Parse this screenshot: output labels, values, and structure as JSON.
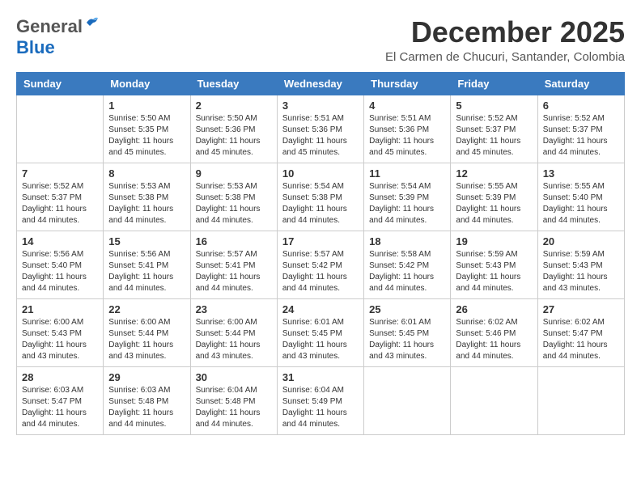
{
  "header": {
    "logo_general": "General",
    "logo_blue": "Blue",
    "month_title": "December 2025",
    "location": "El Carmen de Chucuri, Santander, Colombia"
  },
  "calendar": {
    "days_of_week": [
      "Sunday",
      "Monday",
      "Tuesday",
      "Wednesday",
      "Thursday",
      "Friday",
      "Saturday"
    ],
    "weeks": [
      [
        {
          "day": "",
          "info": ""
        },
        {
          "day": "1",
          "info": "Sunrise: 5:50 AM\nSunset: 5:35 PM\nDaylight: 11 hours\nand 45 minutes."
        },
        {
          "day": "2",
          "info": "Sunrise: 5:50 AM\nSunset: 5:36 PM\nDaylight: 11 hours\nand 45 minutes."
        },
        {
          "day": "3",
          "info": "Sunrise: 5:51 AM\nSunset: 5:36 PM\nDaylight: 11 hours\nand 45 minutes."
        },
        {
          "day": "4",
          "info": "Sunrise: 5:51 AM\nSunset: 5:36 PM\nDaylight: 11 hours\nand 45 minutes."
        },
        {
          "day": "5",
          "info": "Sunrise: 5:52 AM\nSunset: 5:37 PM\nDaylight: 11 hours\nand 45 minutes."
        },
        {
          "day": "6",
          "info": "Sunrise: 5:52 AM\nSunset: 5:37 PM\nDaylight: 11 hours\nand 44 minutes."
        }
      ],
      [
        {
          "day": "7",
          "info": "Sunrise: 5:52 AM\nSunset: 5:37 PM\nDaylight: 11 hours\nand 44 minutes."
        },
        {
          "day": "8",
          "info": "Sunrise: 5:53 AM\nSunset: 5:38 PM\nDaylight: 11 hours\nand 44 minutes."
        },
        {
          "day": "9",
          "info": "Sunrise: 5:53 AM\nSunset: 5:38 PM\nDaylight: 11 hours\nand 44 minutes."
        },
        {
          "day": "10",
          "info": "Sunrise: 5:54 AM\nSunset: 5:38 PM\nDaylight: 11 hours\nand 44 minutes."
        },
        {
          "day": "11",
          "info": "Sunrise: 5:54 AM\nSunset: 5:39 PM\nDaylight: 11 hours\nand 44 minutes."
        },
        {
          "day": "12",
          "info": "Sunrise: 5:55 AM\nSunset: 5:39 PM\nDaylight: 11 hours\nand 44 minutes."
        },
        {
          "day": "13",
          "info": "Sunrise: 5:55 AM\nSunset: 5:40 PM\nDaylight: 11 hours\nand 44 minutes."
        }
      ],
      [
        {
          "day": "14",
          "info": "Sunrise: 5:56 AM\nSunset: 5:40 PM\nDaylight: 11 hours\nand 44 minutes."
        },
        {
          "day": "15",
          "info": "Sunrise: 5:56 AM\nSunset: 5:41 PM\nDaylight: 11 hours\nand 44 minutes."
        },
        {
          "day": "16",
          "info": "Sunrise: 5:57 AM\nSunset: 5:41 PM\nDaylight: 11 hours\nand 44 minutes."
        },
        {
          "day": "17",
          "info": "Sunrise: 5:57 AM\nSunset: 5:42 PM\nDaylight: 11 hours\nand 44 minutes."
        },
        {
          "day": "18",
          "info": "Sunrise: 5:58 AM\nSunset: 5:42 PM\nDaylight: 11 hours\nand 44 minutes."
        },
        {
          "day": "19",
          "info": "Sunrise: 5:59 AM\nSunset: 5:43 PM\nDaylight: 11 hours\nand 44 minutes."
        },
        {
          "day": "20",
          "info": "Sunrise: 5:59 AM\nSunset: 5:43 PM\nDaylight: 11 hours\nand 43 minutes."
        }
      ],
      [
        {
          "day": "21",
          "info": "Sunrise: 6:00 AM\nSunset: 5:43 PM\nDaylight: 11 hours\nand 43 minutes."
        },
        {
          "day": "22",
          "info": "Sunrise: 6:00 AM\nSunset: 5:44 PM\nDaylight: 11 hours\nand 43 minutes."
        },
        {
          "day": "23",
          "info": "Sunrise: 6:00 AM\nSunset: 5:44 PM\nDaylight: 11 hours\nand 43 minutes."
        },
        {
          "day": "24",
          "info": "Sunrise: 6:01 AM\nSunset: 5:45 PM\nDaylight: 11 hours\nand 43 minutes."
        },
        {
          "day": "25",
          "info": "Sunrise: 6:01 AM\nSunset: 5:45 PM\nDaylight: 11 hours\nand 43 minutes."
        },
        {
          "day": "26",
          "info": "Sunrise: 6:02 AM\nSunset: 5:46 PM\nDaylight: 11 hours\nand 44 minutes."
        },
        {
          "day": "27",
          "info": "Sunrise: 6:02 AM\nSunset: 5:47 PM\nDaylight: 11 hours\nand 44 minutes."
        }
      ],
      [
        {
          "day": "28",
          "info": "Sunrise: 6:03 AM\nSunset: 5:47 PM\nDaylight: 11 hours\nand 44 minutes."
        },
        {
          "day": "29",
          "info": "Sunrise: 6:03 AM\nSunset: 5:48 PM\nDaylight: 11 hours\nand 44 minutes."
        },
        {
          "day": "30",
          "info": "Sunrise: 6:04 AM\nSunset: 5:48 PM\nDaylight: 11 hours\nand 44 minutes."
        },
        {
          "day": "31",
          "info": "Sunrise: 6:04 AM\nSunset: 5:49 PM\nDaylight: 11 hours\nand 44 minutes."
        },
        {
          "day": "",
          "info": ""
        },
        {
          "day": "",
          "info": ""
        },
        {
          "day": "",
          "info": ""
        }
      ]
    ]
  }
}
